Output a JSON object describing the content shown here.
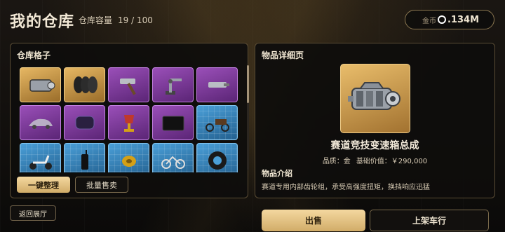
{
  "header": {
    "title": "我的仓库",
    "capacity_label": "仓库容量",
    "capacity_value": "19 / 100",
    "coin_label": "金币",
    "coin_value": ".134M"
  },
  "inventory": {
    "title": "仓库格子",
    "cells": [
      {
        "item": "gearbox",
        "rarity": "gold",
        "selected": true
      },
      {
        "item": "tires",
        "rarity": "gold"
      },
      {
        "item": "hammer",
        "rarity": "purple"
      },
      {
        "item": "robot-arm",
        "rarity": "purple"
      },
      {
        "item": "injector",
        "rarity": "purple"
      },
      {
        "item": "car-model",
        "rarity": "purple"
      },
      {
        "item": "fuel-tank",
        "rarity": "purple"
      },
      {
        "item": "trophy",
        "rarity": "purple"
      },
      {
        "item": "mat",
        "rarity": "purple"
      },
      {
        "item": "tricycle",
        "rarity": "blue"
      },
      {
        "item": "scooter",
        "rarity": "blue"
      },
      {
        "item": "walkie-talkie",
        "rarity": "blue"
      },
      {
        "item": "tape",
        "rarity": "blue"
      },
      {
        "item": "bicycle",
        "rarity": "blue"
      },
      {
        "item": "tire",
        "rarity": "blue"
      }
    ],
    "sort_button": "一键整理",
    "batch_sell_button": "批量售卖"
  },
  "detail": {
    "title": "物品详细页",
    "item_name": "赛道竞技变速箱总成",
    "quality": "品质：金",
    "base_price": "基础价值：￥290,000",
    "intro_title": "物品介绍",
    "intro_text": "赛道专用内部齿轮组，承受高强度扭矩，换挡响应迅猛"
  },
  "footer": {
    "back_button": "返回展厅",
    "sell_button": "出售",
    "list_button": "上架车行"
  },
  "colors": {
    "gold": "#e6b763",
    "purple": "#9a4fb8",
    "blue": "#4a9fd8",
    "accent": "#f4d8a0"
  }
}
